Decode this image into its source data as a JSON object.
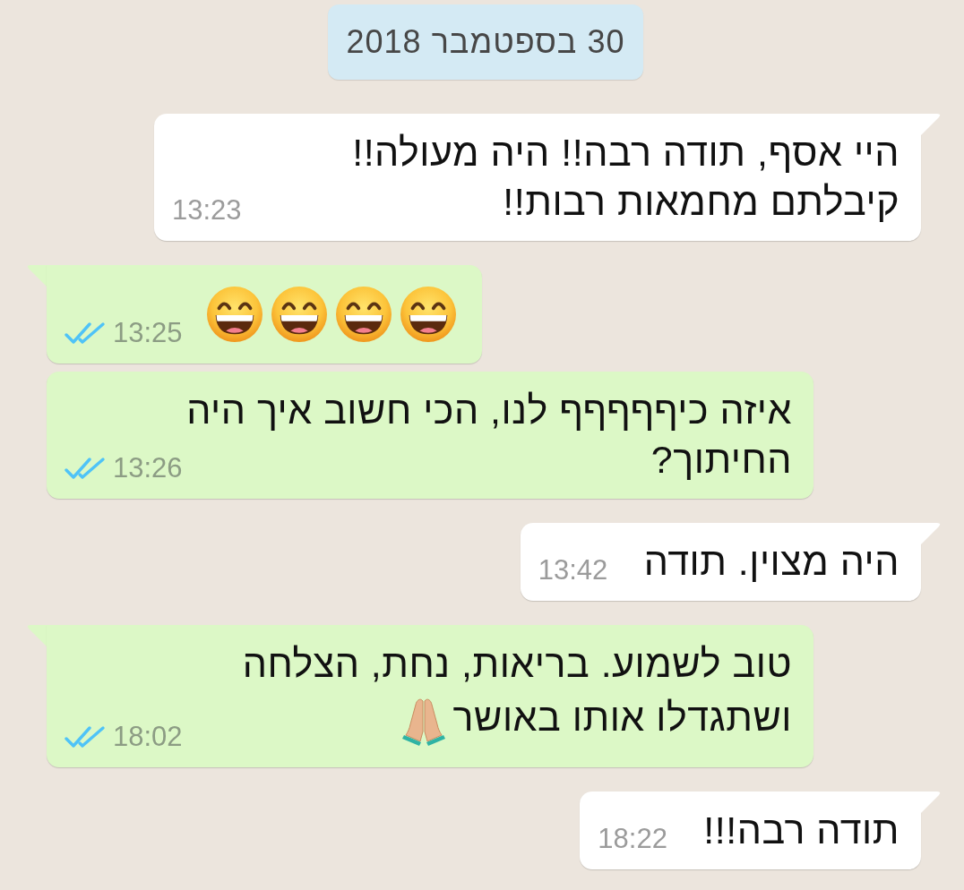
{
  "date_chip": {
    "label": "30 בספטמבר 2018"
  },
  "messages": [
    {
      "kind": "incoming",
      "tail": true,
      "text": "היי אסף, תודה רבה!! היה מעולה!! קיבלתם מחמאות רבות!!",
      "time": "13:23"
    },
    {
      "kind": "outgoing",
      "tail": true,
      "emojis": [
        {
          "kind": "grin"
        },
        {
          "kind": "grin"
        },
        {
          "kind": "grin"
        },
        {
          "kind": "grin"
        }
      ],
      "time": "13:25",
      "read": true
    },
    {
      "kind": "outgoing",
      "tail": false,
      "text": "איזה כיףףףףף לנו, הכי חשוב איך היה החיתוך?",
      "time": "13:26",
      "read": true
    },
    {
      "kind": "incoming",
      "tail": true,
      "text": "היה מצוין. תודה",
      "time": "13:42"
    },
    {
      "kind": "outgoing",
      "tail": true,
      "text": "טוב לשמוע. בריאות, נחת, הצלחה ושתגדלו אותו באושר",
      "emojis": [
        {
          "kind": "pray"
        }
      ],
      "time": "18:02",
      "read": true
    },
    {
      "kind": "incoming",
      "tail": true,
      "text": "תודה רבה!!!",
      "time": "18:22"
    }
  ]
}
